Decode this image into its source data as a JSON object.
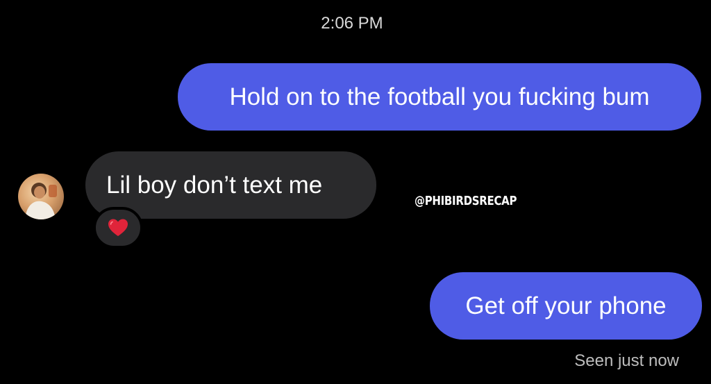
{
  "thread": {
    "timestamp": "2:06 PM",
    "messages": [
      {
        "direction": "outgoing",
        "text": "Hold on to the football you fucking bum"
      },
      {
        "direction": "incoming",
        "text": "Lil boy don’t text me",
        "reaction_icon": "heart-icon"
      },
      {
        "direction": "outgoing",
        "text": "Get off your phone"
      }
    ],
    "read_receipt": "Seen just now"
  },
  "watermark": "@PHIBIRDSRECAP",
  "colors": {
    "background": "#000000",
    "outgoing_bubble": "#4f5ce6",
    "incoming_bubble": "#2a2a2c",
    "reaction_heart": "#e0243a",
    "secondary_text": "#bdbdbd"
  }
}
